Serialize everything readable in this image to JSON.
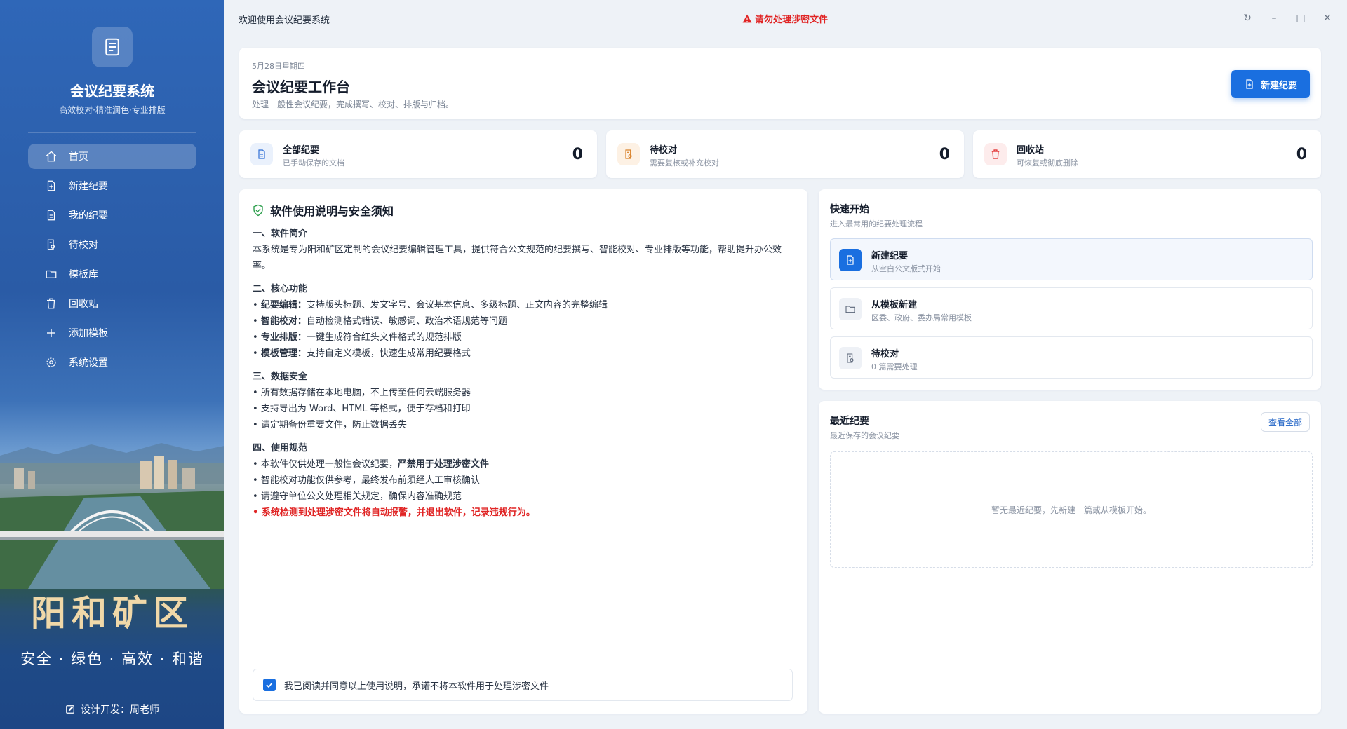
{
  "sidebar": {
    "app_title": "会议纪要系统",
    "app_subtitle": "高效校对·精准润色·专业排版",
    "items": [
      {
        "label": "首页",
        "icon": "home-icon",
        "active": true
      },
      {
        "label": "新建纪要",
        "icon": "new-document-icon"
      },
      {
        "label": "我的纪要",
        "icon": "document-icon"
      },
      {
        "label": "待校对",
        "icon": "review-document-icon"
      },
      {
        "label": "模板库",
        "icon": "folder-icon"
      },
      {
        "label": "回收站",
        "icon": "trash-icon"
      },
      {
        "label": "添加模板",
        "icon": "plus-icon"
      },
      {
        "label": "系统设置",
        "icon": "gear-icon"
      }
    ],
    "slogan_big": "阳和矿区",
    "slogan_small": "安全 · 绿色 · 高效 · 和谐",
    "developer": "设计开发：周老师"
  },
  "topbar": {
    "welcome": "欢迎使用会议纪要系统",
    "warning": "请勿处理涉密文件"
  },
  "header": {
    "date": "5月28日星期四",
    "title": "会议纪要工作台",
    "description": "处理一般性会议纪要，完成撰写、校对、排版与归档。",
    "new_button": "新建纪要"
  },
  "stats": [
    {
      "title": "全部纪要",
      "subtitle": "已手动保存的文档",
      "value": "0",
      "color": "#2f6fd6"
    },
    {
      "title": "待校对",
      "subtitle": "需要复核或补充校对",
      "value": "0",
      "color": "#d9822b"
    },
    {
      "title": "回收站",
      "subtitle": "可恢复或彻底删除",
      "value": "0",
      "color": "#e02424"
    }
  ],
  "instructions": {
    "title": "软件使用说明与安全须知",
    "s1_title": "一、软件简介",
    "s1_text": "本系统是专为阳和矿区定制的会议纪要编辑管理工具，提供符合公文规范的纪要撰写、智能校对、专业排版等功能，帮助提升办公效率。",
    "s2_title": "二、核心功能",
    "s2_items": [
      {
        "bold": "纪要编辑：",
        "text": "支持版头标题、发文字号、会议基本信息、多级标题、正文内容的完整编辑"
      },
      {
        "bold": "智能校对：",
        "text": "自动检测格式错误、敏感词、政治术语规范等问题"
      },
      {
        "bold": "专业排版：",
        "text": "一键生成符合红头文件格式的规范排版"
      },
      {
        "bold": "模板管理：",
        "text": "支持自定义模板，快速生成常用纪要格式"
      }
    ],
    "s3_title": "三、数据安全",
    "s3_items": [
      "所有数据存储在本地电脑，不上传至任何云端服务器",
      "支持导出为 Word、HTML 等格式，便于存档和打印",
      "请定期备份重要文件，防止数据丢失"
    ],
    "s4_title": "四、使用规范",
    "s4_item1_text": "本软件仅供处理一般性会议纪要，",
    "s4_item1_bold": "严禁用于处理涉密文件",
    "s4_item2": "智能校对功能仅供参考，最终发布前须经人工审核确认",
    "s4_item3": "请遵守单位公文处理相关规定，确保内容准确规范",
    "s4_item4_red": "系统检测到处理涉密文件将自动报警，并退出软件，记录违规行为。",
    "agree_text": "我已阅读并同意以上使用说明，承诺不将本软件用于处理涉密文件",
    "agree_checked": true
  },
  "quick": {
    "title": "快速开始",
    "subtitle": "进入最常用的纪要处理流程",
    "items": [
      {
        "title": "新建纪要",
        "subtitle": "从空白公文版式开始",
        "icon": "new-document-icon"
      },
      {
        "title": "从模板新建",
        "subtitle": "区委、政府、委办局常用模板",
        "icon": "folder-icon"
      },
      {
        "title": "待校对",
        "subtitle": "0 篇需要处理",
        "icon": "review-document-icon"
      }
    ]
  },
  "recent": {
    "title": "最近纪要",
    "subtitle": "最近保存的会议纪要",
    "view_all": "查看全部",
    "empty_text": "暂无最近纪要，先新建一篇或从模板开始。"
  },
  "colors": {
    "accent": "#1a6fe0",
    "warning": "#e02424",
    "sidebar": "#2a5ba6"
  }
}
